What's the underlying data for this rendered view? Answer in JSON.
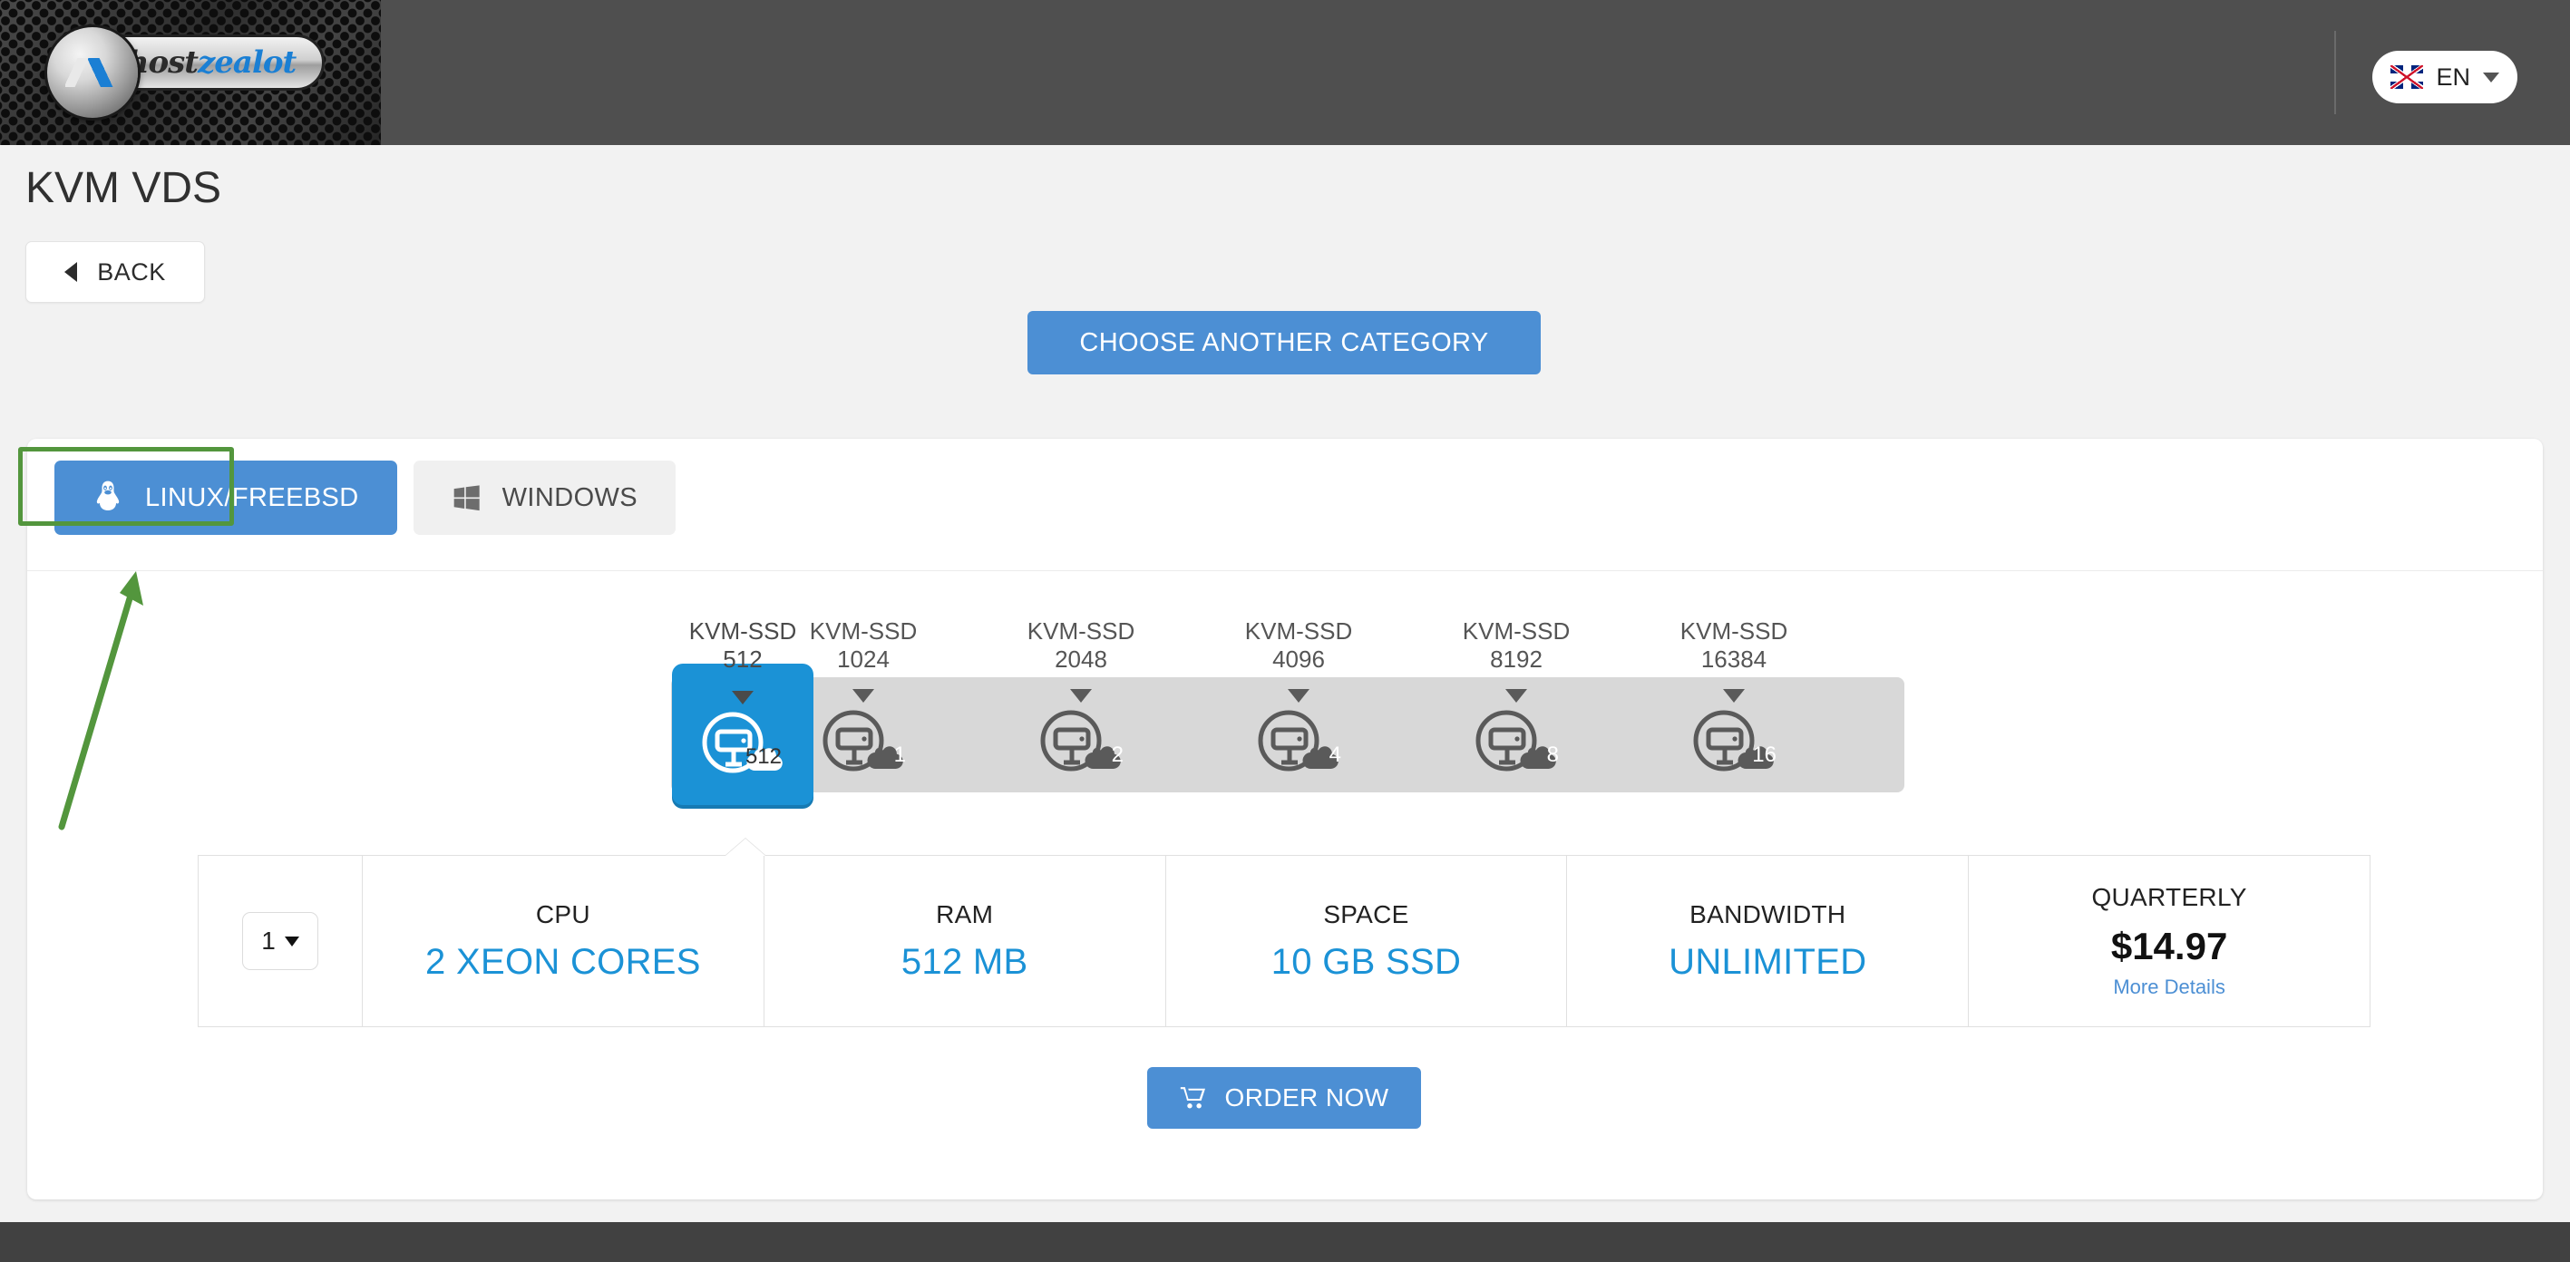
{
  "header": {
    "logo_text_primary": "host",
    "logo_text_accent": "zealot",
    "language_code": "EN",
    "flag_icon": "uk-flag-icon",
    "dropdown_icon": "chevron-down-icon"
  },
  "page": {
    "title": "KVM VDS",
    "back_label": "BACK",
    "back_icon": "chevron-left-icon",
    "category_button_label": "CHOOSE ANOTHER CATEGORY"
  },
  "os_tabs": [
    {
      "label": "LINUX/FREEBSD",
      "icon": "linux-penguin-icon",
      "active": true
    },
    {
      "label": "WINDOWS",
      "icon": "windows-logo-icon",
      "active": false
    }
  ],
  "plans": [
    {
      "name": "KVM-SSD\n512",
      "badge": "512",
      "selected": true
    },
    {
      "name": "KVM-SSD\n1024",
      "badge": "1",
      "selected": false
    },
    {
      "name": "KVM-SSD\n2048",
      "badge": "2",
      "selected": false
    },
    {
      "name": "KVM-SSD\n4096",
      "badge": "4",
      "selected": false
    },
    {
      "name": "KVM-SSD\n8192",
      "badge": "8",
      "selected": false
    },
    {
      "name": "KVM-SSD\n16384",
      "badge": "16",
      "selected": false
    }
  ],
  "spec_table": {
    "quantity_value": "1",
    "columns": [
      {
        "header": "CPU",
        "value": "2 XEON CORES"
      },
      {
        "header": "RAM",
        "value": "512 MB"
      },
      {
        "header": "SPACE",
        "value": "10 GB SSD"
      },
      {
        "header": "BANDWIDTH",
        "value": "UNLIMITED"
      }
    ],
    "price_header": "QUARTERLY",
    "price_value": "$14.97",
    "more_details_label": "More Details"
  },
  "order": {
    "label": "ORDER NOW",
    "icon": "shopping-cart-icon"
  },
  "colors": {
    "accent_blue": "#4c8fd4",
    "value_blue": "#1b92d6",
    "header_gray": "#4f4f4f",
    "footer_gray": "#414141",
    "annotation_green": "#53963d",
    "track_gray": "#d8d8d8"
  }
}
